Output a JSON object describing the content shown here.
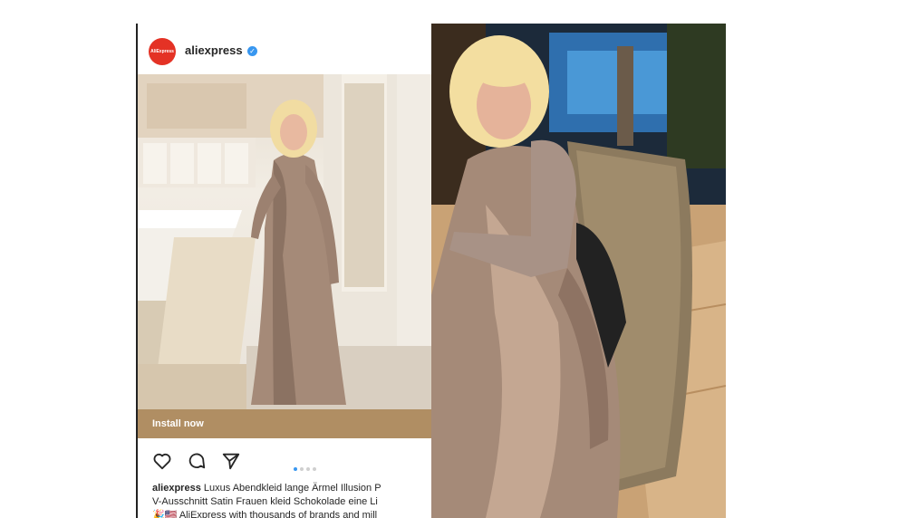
{
  "post": {
    "brand_avatar_text": "AliExpress",
    "username": "aliexpress",
    "verified_mark": "✓",
    "install_label": "Install now",
    "carousel": {
      "total": 4,
      "active": 1
    },
    "caption": {
      "username": "aliexpress",
      "line1": "Luxus Abendkleid lange Ärmel Illusion P",
      "line2": "V-Ausschnitt Satin Frauen kleid Schokolade eine Li",
      "line3": "🎉🇺🇸 AliExpress with thousands of brands and mill"
    }
  },
  "icons": {
    "like": "heart-icon",
    "comment": "comment-icon",
    "share": "send-icon",
    "verified": "verified-badge-icon"
  },
  "colors": {
    "brand_red": "#e43225",
    "install_bar": "#b08e63",
    "verified_blue": "#3897f0",
    "dress_satin": "#a58a78"
  }
}
